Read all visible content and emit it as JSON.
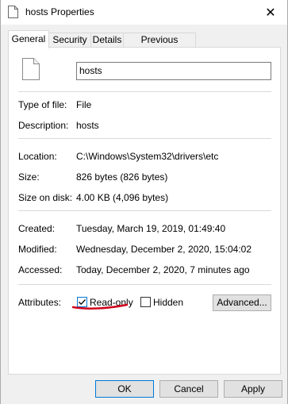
{
  "window": {
    "title": "hosts Properties",
    "close_glyph": "✕"
  },
  "tabs": [
    {
      "label": "General"
    },
    {
      "label": "Security"
    },
    {
      "label": "Details"
    },
    {
      "label": "Previous Versions"
    }
  ],
  "general": {
    "file_name": "hosts",
    "type_label": "Type of file:",
    "type_value": "File",
    "description_label": "Description:",
    "description_value": "hosts",
    "location_label": "Location:",
    "location_value": "C:\\Windows\\System32\\drivers\\etc",
    "size_label": "Size:",
    "size_value": "826 bytes (826 bytes)",
    "size_on_disk_label": "Size on disk:",
    "size_on_disk_value": "4.00 KB (4,096 bytes)",
    "created_label": "Created:",
    "created_value": "Tuesday, March 19, 2019, 01:49:40",
    "modified_label": "Modified:",
    "modified_value": "Wednesday, December 2, 2020, 15:04:02",
    "accessed_label": "Accessed:",
    "accessed_value": "Today, December 2, 2020, 7 minutes ago",
    "attributes_label": "Attributes:",
    "readonly_label": "Read-only",
    "readonly_checked": true,
    "hidden_label": "Hidden",
    "hidden_checked": false,
    "advanced_label": "Advanced..."
  },
  "buttons": {
    "ok": "OK",
    "cancel": "Cancel",
    "apply": "Apply"
  },
  "colors": {
    "accent": "#0078d7",
    "annotation": "#d0021b"
  }
}
